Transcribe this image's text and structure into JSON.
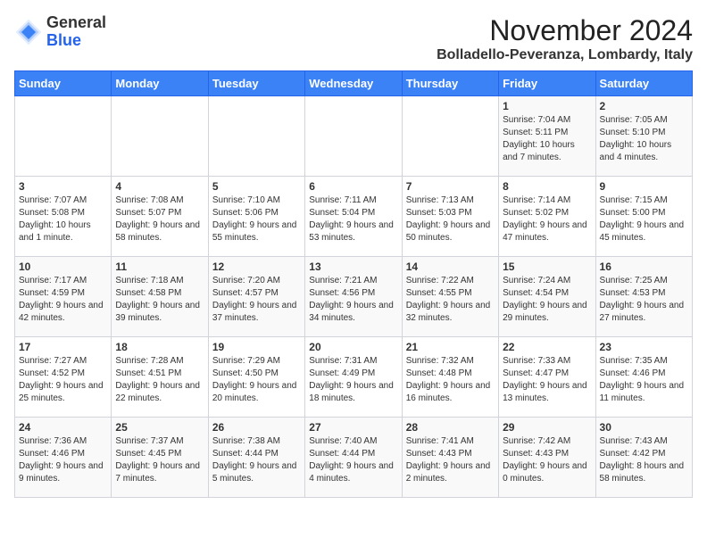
{
  "header": {
    "logo_line1": "General",
    "logo_line2": "Blue",
    "month_title": "November 2024",
    "location": "Bolladello-Peveranza, Lombardy, Italy"
  },
  "days_of_week": [
    "Sunday",
    "Monday",
    "Tuesday",
    "Wednesday",
    "Thursday",
    "Friday",
    "Saturday"
  ],
  "weeks": [
    [
      {
        "day": "",
        "info": ""
      },
      {
        "day": "",
        "info": ""
      },
      {
        "day": "",
        "info": ""
      },
      {
        "day": "",
        "info": ""
      },
      {
        "day": "",
        "info": ""
      },
      {
        "day": "1",
        "info": "Sunrise: 7:04 AM\nSunset: 5:11 PM\nDaylight: 10 hours and 7 minutes."
      },
      {
        "day": "2",
        "info": "Sunrise: 7:05 AM\nSunset: 5:10 PM\nDaylight: 10 hours and 4 minutes."
      }
    ],
    [
      {
        "day": "3",
        "info": "Sunrise: 7:07 AM\nSunset: 5:08 PM\nDaylight: 10 hours and 1 minute."
      },
      {
        "day": "4",
        "info": "Sunrise: 7:08 AM\nSunset: 5:07 PM\nDaylight: 9 hours and 58 minutes."
      },
      {
        "day": "5",
        "info": "Sunrise: 7:10 AM\nSunset: 5:06 PM\nDaylight: 9 hours and 55 minutes."
      },
      {
        "day": "6",
        "info": "Sunrise: 7:11 AM\nSunset: 5:04 PM\nDaylight: 9 hours and 53 minutes."
      },
      {
        "day": "7",
        "info": "Sunrise: 7:13 AM\nSunset: 5:03 PM\nDaylight: 9 hours and 50 minutes."
      },
      {
        "day": "8",
        "info": "Sunrise: 7:14 AM\nSunset: 5:02 PM\nDaylight: 9 hours and 47 minutes."
      },
      {
        "day": "9",
        "info": "Sunrise: 7:15 AM\nSunset: 5:00 PM\nDaylight: 9 hours and 45 minutes."
      }
    ],
    [
      {
        "day": "10",
        "info": "Sunrise: 7:17 AM\nSunset: 4:59 PM\nDaylight: 9 hours and 42 minutes."
      },
      {
        "day": "11",
        "info": "Sunrise: 7:18 AM\nSunset: 4:58 PM\nDaylight: 9 hours and 39 minutes."
      },
      {
        "day": "12",
        "info": "Sunrise: 7:20 AM\nSunset: 4:57 PM\nDaylight: 9 hours and 37 minutes."
      },
      {
        "day": "13",
        "info": "Sunrise: 7:21 AM\nSunset: 4:56 PM\nDaylight: 9 hours and 34 minutes."
      },
      {
        "day": "14",
        "info": "Sunrise: 7:22 AM\nSunset: 4:55 PM\nDaylight: 9 hours and 32 minutes."
      },
      {
        "day": "15",
        "info": "Sunrise: 7:24 AM\nSunset: 4:54 PM\nDaylight: 9 hours and 29 minutes."
      },
      {
        "day": "16",
        "info": "Sunrise: 7:25 AM\nSunset: 4:53 PM\nDaylight: 9 hours and 27 minutes."
      }
    ],
    [
      {
        "day": "17",
        "info": "Sunrise: 7:27 AM\nSunset: 4:52 PM\nDaylight: 9 hours and 25 minutes."
      },
      {
        "day": "18",
        "info": "Sunrise: 7:28 AM\nSunset: 4:51 PM\nDaylight: 9 hours and 22 minutes."
      },
      {
        "day": "19",
        "info": "Sunrise: 7:29 AM\nSunset: 4:50 PM\nDaylight: 9 hours and 20 minutes."
      },
      {
        "day": "20",
        "info": "Sunrise: 7:31 AM\nSunset: 4:49 PM\nDaylight: 9 hours and 18 minutes."
      },
      {
        "day": "21",
        "info": "Sunrise: 7:32 AM\nSunset: 4:48 PM\nDaylight: 9 hours and 16 minutes."
      },
      {
        "day": "22",
        "info": "Sunrise: 7:33 AM\nSunset: 4:47 PM\nDaylight: 9 hours and 13 minutes."
      },
      {
        "day": "23",
        "info": "Sunrise: 7:35 AM\nSunset: 4:46 PM\nDaylight: 9 hours and 11 minutes."
      }
    ],
    [
      {
        "day": "24",
        "info": "Sunrise: 7:36 AM\nSunset: 4:46 PM\nDaylight: 9 hours and 9 minutes."
      },
      {
        "day": "25",
        "info": "Sunrise: 7:37 AM\nSunset: 4:45 PM\nDaylight: 9 hours and 7 minutes."
      },
      {
        "day": "26",
        "info": "Sunrise: 7:38 AM\nSunset: 4:44 PM\nDaylight: 9 hours and 5 minutes."
      },
      {
        "day": "27",
        "info": "Sunrise: 7:40 AM\nSunset: 4:44 PM\nDaylight: 9 hours and 4 minutes."
      },
      {
        "day": "28",
        "info": "Sunrise: 7:41 AM\nSunset: 4:43 PM\nDaylight: 9 hours and 2 minutes."
      },
      {
        "day": "29",
        "info": "Sunrise: 7:42 AM\nSunset: 4:43 PM\nDaylight: 9 hours and 0 minutes."
      },
      {
        "day": "30",
        "info": "Sunrise: 7:43 AM\nSunset: 4:42 PM\nDaylight: 8 hours and 58 minutes."
      }
    ]
  ]
}
